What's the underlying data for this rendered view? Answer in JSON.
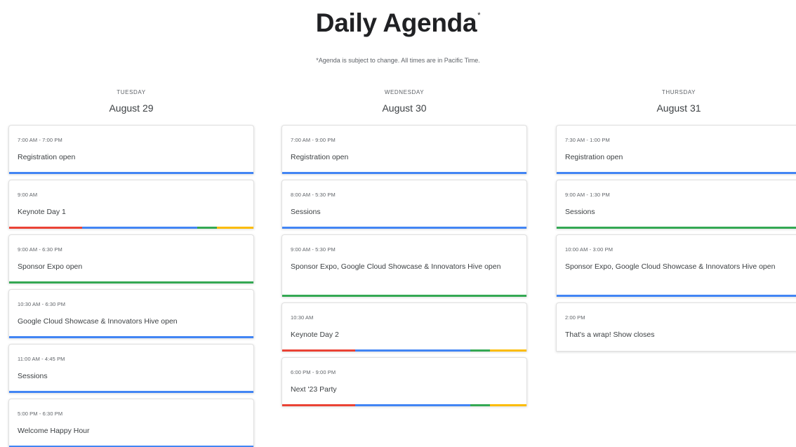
{
  "header": {
    "title": "Daily Agenda",
    "title_mark": "*",
    "disclaimer": "*Agenda is subject to change. All times are in Pacific Time."
  },
  "colors": {
    "blue": "#4285f4",
    "red": "#ea4335",
    "green": "#34a853",
    "yellow": "#fbbc04"
  },
  "days": [
    {
      "weekday": "TUESDAY",
      "date": "August 29",
      "events": [
        {
          "time": "7:00 AM - 7:00 PM",
          "title": "Registration open",
          "bar": "blue"
        },
        {
          "time": "9:00 AM",
          "title": "Keynote Day 1",
          "bar": "multi"
        },
        {
          "time": "9:00 AM - 6:30 PM",
          "title": "Sponsor Expo open",
          "bar": "green"
        },
        {
          "time": "10:30 AM - 6:30 PM",
          "title": "Google Cloud Showcase & Innovators Hive open",
          "bar": "blue"
        },
        {
          "time": "11:00 AM - 4:45 PM",
          "title": "Sessions",
          "bar": "blue"
        },
        {
          "time": "5:00 PM - 6:30 PM",
          "title": "Welcome Happy Hour",
          "bar": "blue"
        }
      ]
    },
    {
      "weekday": "WEDNESDAY",
      "date": "August 30",
      "events": [
        {
          "time": "7:00 AM - 9:00 PM",
          "title": "Registration open",
          "bar": "blue"
        },
        {
          "time": "8:00 AM - 5:30 PM",
          "title": "Sessions",
          "bar": "blue"
        },
        {
          "time": "9:00 AM - 5:30 PM",
          "title": "Sponsor Expo, Google Cloud Showcase & Innovators Hive open",
          "bar": "green"
        },
        {
          "time": "10:30 AM",
          "title": "Keynote Day 2",
          "bar": "multi"
        },
        {
          "time": "6:00 PM - 9:00 PM",
          "title": "Next '23 Party",
          "bar": "multi"
        }
      ]
    },
    {
      "weekday": "THURSDAY",
      "date": "August 31",
      "events": [
        {
          "time": "7:30 AM - 1:00 PM",
          "title": "Registration open",
          "bar": "blue"
        },
        {
          "time": "9:00 AM - 1:30 PM",
          "title": "Sessions",
          "bar": "green"
        },
        {
          "time": "10:00 AM - 3:00 PM",
          "title": "Sponsor Expo, Google Cloud Showcase & Innovators Hive open",
          "bar": "blue"
        },
        {
          "time": "2:00 PM",
          "title": "That's a wrap! Show closes",
          "bar": "none"
        }
      ]
    }
  ]
}
